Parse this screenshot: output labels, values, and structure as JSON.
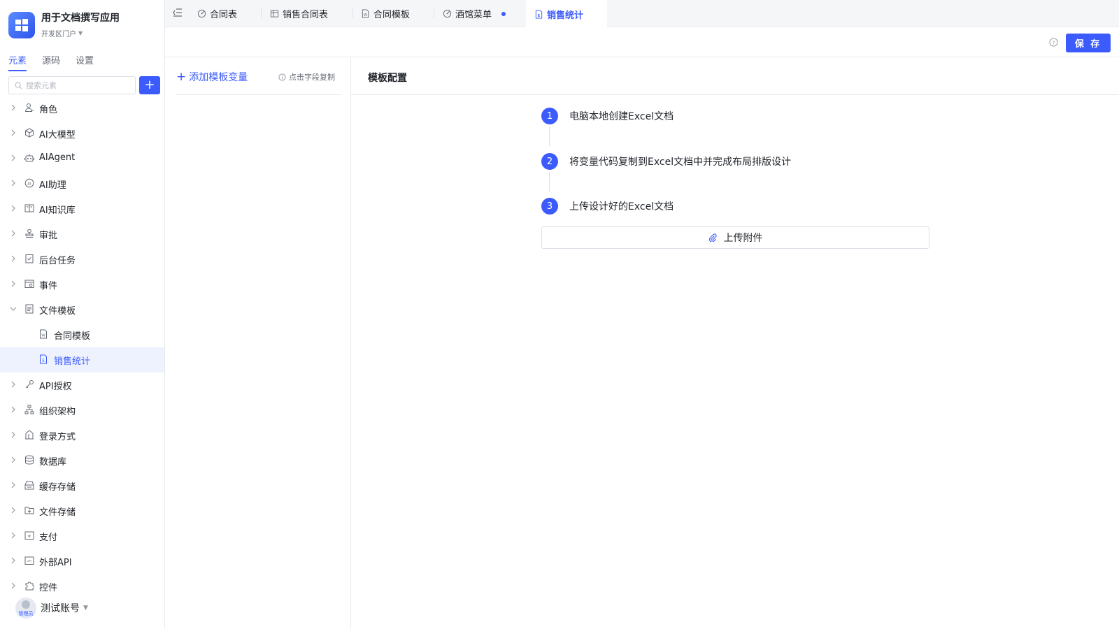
{
  "app": {
    "title": "用于文档撰写应用",
    "portal": "开发区门户"
  },
  "sidebar": {
    "tabs": [
      "元素",
      "源码",
      "设置"
    ],
    "search_placeholder": "搜索元素",
    "items": [
      {
        "label": "角色",
        "icon": "role-icon"
      },
      {
        "label": "AI大模型",
        "icon": "ai-model-icon"
      },
      {
        "label": "AIAgent",
        "icon": "robot-icon"
      },
      {
        "label": "AI助理",
        "icon": "ai-assistant-icon"
      },
      {
        "label": "AI知识库",
        "icon": "knowledge-base-icon"
      },
      {
        "label": "审批",
        "icon": "stamp-icon"
      },
      {
        "label": "后台任务",
        "icon": "task-icon"
      },
      {
        "label": "事件",
        "icon": "event-icon"
      },
      {
        "label": "文件模板",
        "icon": "document-icon"
      },
      {
        "label": "合同模板",
        "icon": "word-file-icon"
      },
      {
        "label": "销售统计",
        "icon": "excel-file-icon"
      },
      {
        "label": "API授权",
        "icon": "key-icon"
      },
      {
        "label": "组织架构",
        "icon": "org-chart-icon"
      },
      {
        "label": "登录方式",
        "icon": "login-icon"
      },
      {
        "label": "数据库",
        "icon": "database-icon"
      },
      {
        "label": "缓存存储",
        "icon": "cache-icon"
      },
      {
        "label": "文件存储",
        "icon": "file-storage-icon"
      },
      {
        "label": "支付",
        "icon": "payment-icon"
      },
      {
        "label": "外部API",
        "icon": "api-icon"
      },
      {
        "label": "控件",
        "icon": "puzzle-icon"
      }
    ],
    "user": {
      "name": "测试账号",
      "role_tag": "管理员"
    }
  },
  "tabs": [
    {
      "label": "合同表",
      "icon": "table-view-icon"
    },
    {
      "label": "销售合同表",
      "icon": "table-icon"
    },
    {
      "label": "合同模板",
      "icon": "word-file-icon"
    },
    {
      "label": "酒馆菜单",
      "icon": "table-view-icon"
    },
    {
      "label": "销售统计",
      "icon": "excel-file-icon",
      "active": true
    }
  ],
  "toolbar": {
    "save_label": "保 存"
  },
  "variables": {
    "add_label": "添加模板变量",
    "copy_hint": "点击字段复制"
  },
  "config": {
    "title": "模板配置",
    "steps": [
      {
        "num": "1",
        "text": "电脑本地创建Excel文档"
      },
      {
        "num": "2",
        "text": "将变量代码复制到Excel文档中并完成布局排版设计"
      },
      {
        "num": "3",
        "text": "上传设计好的Excel文档"
      }
    ],
    "upload_label": "上传附件"
  },
  "colors": {
    "accent": "#3b5bfd"
  }
}
